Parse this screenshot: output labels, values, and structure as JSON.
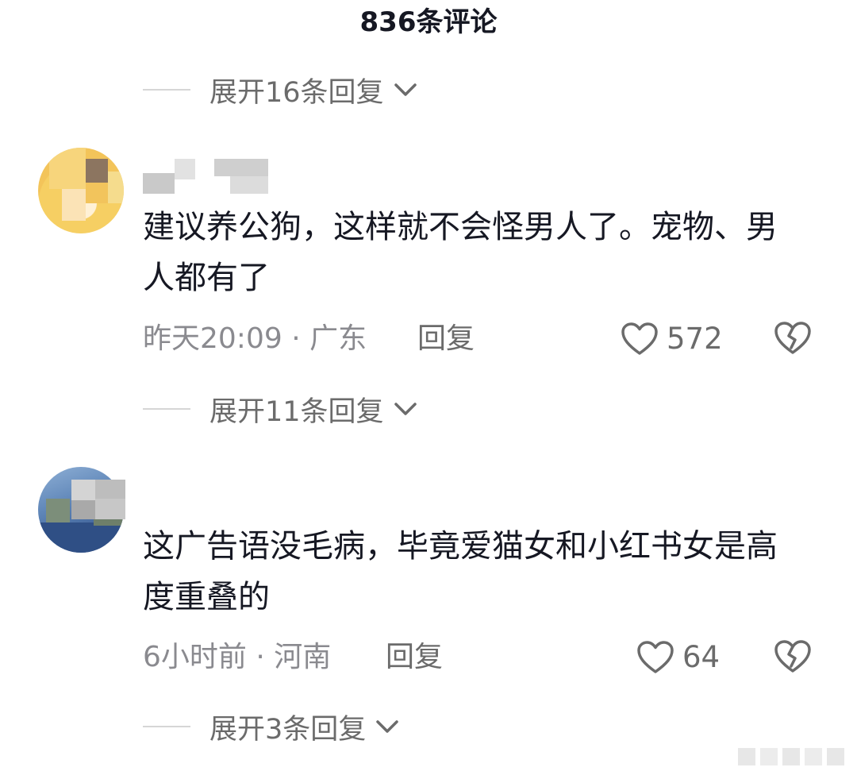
{
  "header": {
    "title": "836条评论"
  },
  "threads": [
    {
      "expand_label": "展开16条回复"
    },
    {
      "expand_label": "展开11条回复"
    },
    {
      "expand_label": "展开3条回复"
    }
  ],
  "comments": [
    {
      "text": "建议养公狗，这样就不会怪男人了。宠物、男人都有了",
      "meta": "昨天20:09 · 广东",
      "reply_label": "回复",
      "like_count": "572"
    },
    {
      "text": "这广告语没毛病，毕竟爱猫女和小红书女是高度重叠的",
      "meta": "6小时前 · 河南",
      "reply_label": "回复",
      "like_count": "64"
    }
  ],
  "colors": {
    "text": "#161823",
    "muted": "#8a8a8f",
    "icon": "#6b6b6b"
  }
}
